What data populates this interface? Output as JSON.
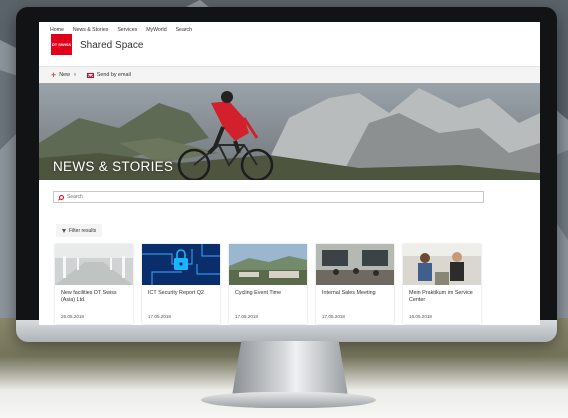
{
  "topnav": [
    "Home",
    "News & Stories",
    "Services",
    "MyWorld",
    "Search"
  ],
  "site": {
    "logo_text": "DT SWISS",
    "title": "Shared Space"
  },
  "commandbar": {
    "new_label": "New",
    "send_label": "Send by email"
  },
  "hero": {
    "title": "NEWS & STORIES"
  },
  "search": {
    "placeholder": "Search"
  },
  "filter": {
    "label": "Filter results"
  },
  "news": [
    {
      "title": "New facilities DT Swiss (Asia) Ltd.",
      "date": "25.05.2018"
    },
    {
      "title": "ICT Security Report Q2",
      "date": "17.05.2018"
    },
    {
      "title": "Cycling Event Time",
      "date": "17.05.2018"
    },
    {
      "title": "Internal Sales Meeting",
      "date": "17.05.2018"
    },
    {
      "title": "Mein Praktikum im Service Center",
      "date": "16.05.2018"
    }
  ],
  "colors": {
    "brand": "#e2001a",
    "bezel": "#111315"
  },
  "icons": [
    "plus-icon",
    "chevron-down-icon",
    "mail-icon",
    "search-icon",
    "filter-icon"
  ]
}
